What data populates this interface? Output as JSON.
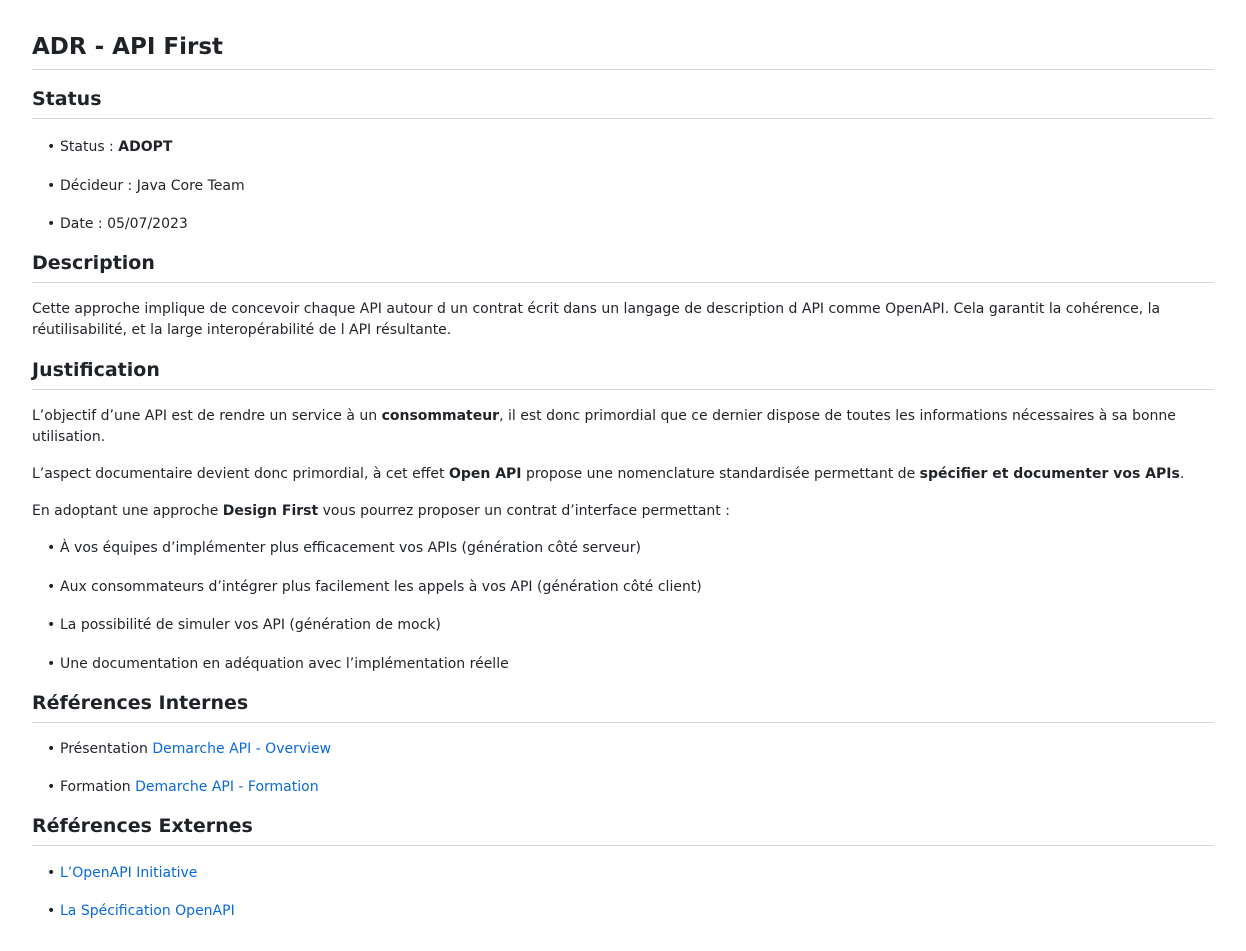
{
  "title": "ADR - API First",
  "status_section": {
    "heading": "Status",
    "items": [
      {
        "label": "Status : ",
        "value": "ADOPT"
      },
      {
        "label": "Décideur : ",
        "value": "Java Core Team"
      },
      {
        "label": "Date : ",
        "value": "05/07/2023"
      }
    ]
  },
  "description_section": {
    "heading": "Description",
    "text": "Cette approche implique de concevoir chaque API autour d un contrat écrit dans un langage de description d API comme OpenAPI. Cela garantit la cohérence, la réutilisabilité, et la large interopérabilité de l API résultante."
  },
  "justification_section": {
    "heading": "Justification",
    "p1": {
      "before": "L’objectif d’une API est de rendre un service à un ",
      "bold": "consommateur",
      "after": ", il est donc primordial que ce dernier dispose de toutes les informations nécessaires à sa bonne utilisation."
    },
    "p2": {
      "before": "L’aspect documentaire devient donc primordial, à cet effet ",
      "bold1": "Open API",
      "middle": " propose une nomenclature standardisée permettant de ",
      "bold2": "spécifier et documenter vos APIs",
      "after": "."
    },
    "p3": {
      "before": "En adoptant une approche ",
      "bold": "Design First",
      "after": " vous pourrez proposer un contrat d’interface permettant :"
    },
    "items": [
      "À vos équipes d’implémenter plus efficacement vos APIs (génération côté serveur)",
      "Aux consommateurs d’intégrer plus facilement les appels à vos API (génération côté client)",
      "La possibilité de simuler vos API (génération de mock)",
      "Une documentation en adéquation avec l’implémentation réelle"
    ]
  },
  "internal_refs_section": {
    "heading": "Références Internes",
    "items": [
      {
        "label": "Présentation ",
        "link": "Demarche API - Overview"
      },
      {
        "label": "Formation ",
        "link": "Demarche API - Formation"
      }
    ]
  },
  "external_refs_section": {
    "heading": "Références Externes",
    "items": [
      {
        "link": "L’OpenAPI Initiative"
      },
      {
        "link": "La Spécification OpenAPI"
      }
    ]
  },
  "colors": {
    "text": "#1f2328",
    "link": "#0969da",
    "rule": "#d1d9e0"
  }
}
